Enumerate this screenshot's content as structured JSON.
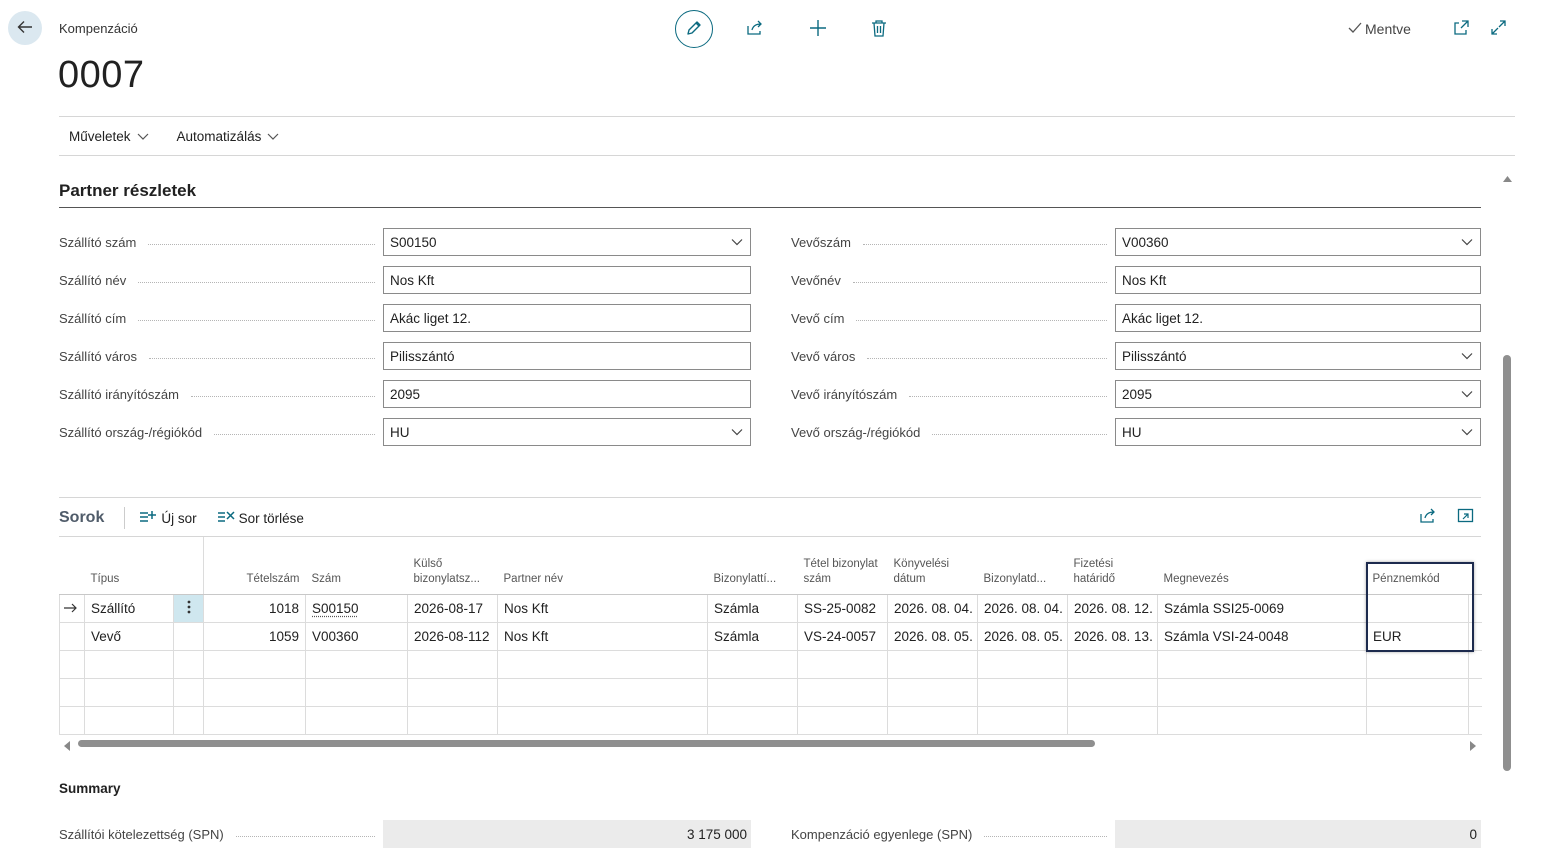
{
  "header": {
    "breadcrumb": "Kompenzáció",
    "title": "0007",
    "saved_label": "Mentve",
    "icons": [
      "back-arrow-icon",
      "edit-icon",
      "share-icon",
      "add-icon",
      "delete-icon",
      "open-new-window-icon",
      "expand-icon"
    ]
  },
  "menu": {
    "items": [
      {
        "label": "Műveletek"
      },
      {
        "label": "Automatizálás"
      }
    ]
  },
  "partner": {
    "section_title": "Partner részletek",
    "vendor": [
      {
        "label": "Szállító szám",
        "value": "S00150",
        "dropdown": true
      },
      {
        "label": "Szállító név",
        "value": "Nos Kft",
        "dropdown": false
      },
      {
        "label": "Szállító cím",
        "value": "Akác liget 12.",
        "dropdown": false
      },
      {
        "label": "Szállító város",
        "value": "Pilisszántó",
        "dropdown": false
      },
      {
        "label": "Szállító irányítószám",
        "value": "2095",
        "dropdown": false
      },
      {
        "label": "Szállító ország-/régiókód",
        "value": "HU",
        "dropdown": true
      }
    ],
    "customer": [
      {
        "label": "Vevőszám",
        "value": "V00360",
        "dropdown": true
      },
      {
        "label": "Vevőnév",
        "value": "Nos Kft",
        "dropdown": false
      },
      {
        "label": "Vevő cím",
        "value": "Akác liget 12.",
        "dropdown": false
      },
      {
        "label": "Vevő város",
        "value": "Pilisszántó",
        "dropdown": true
      },
      {
        "label": "Vevő irányítószám",
        "value": "2095",
        "dropdown": true
      },
      {
        "label": "Vevő ország-/régiókód",
        "value": "HU",
        "dropdown": true
      }
    ]
  },
  "lines": {
    "title": "Sorok",
    "new_line_label": "Új sor",
    "delete_line_label": "Sor törlése",
    "columns": [
      "Típus",
      "",
      "Tételszám",
      "Szám",
      "Külső bizonylatsz...",
      "Partner név",
      "Bizonylattí...",
      "Tétel bizonylat szám",
      "Könyvelési dátum",
      "Bizonylatd...",
      "Fizetési határidő",
      "Megnevezés",
      "Pénznemkód"
    ],
    "rows": [
      {
        "type": "Szállító",
        "entry_no": "1018",
        "number": "S00150",
        "ext_doc": "2026-08-17",
        "partner": "Nos Kft",
        "doc_type": "Számla",
        "entry_doc_no": "SS-25-0082",
        "posting_date": "2026. 08. 04.",
        "doc_date": "2026. 08. 04.",
        "due_date": "2026. 08. 12.",
        "description": "Számla SSI25-0069",
        "currency": ""
      },
      {
        "type": "Vevő",
        "entry_no": "1059",
        "number": "V00360",
        "ext_doc": "2026-08-112",
        "partner": "Nos Kft",
        "doc_type": "Számla",
        "entry_doc_no": "VS-24-0057",
        "posting_date": "2026. 08. 05.",
        "doc_date": "2026. 08. 05.",
        "due_date": "2026. 08. 13.",
        "description": "Számla VSI-24-0048",
        "currency": "EUR"
      }
    ]
  },
  "summary": {
    "title": "Summary",
    "vendor_liability_label": "Szállítói kötelezettség (SPN)",
    "vendor_liability_value": "3 175 000",
    "balance_label": "Kompenzáció egyenlege (SPN)",
    "balance_value": "0"
  },
  "colors": {
    "accent": "#0b6a80",
    "highlight_border": "#1d2b4e",
    "readonly_bg": "#ebebeb"
  }
}
